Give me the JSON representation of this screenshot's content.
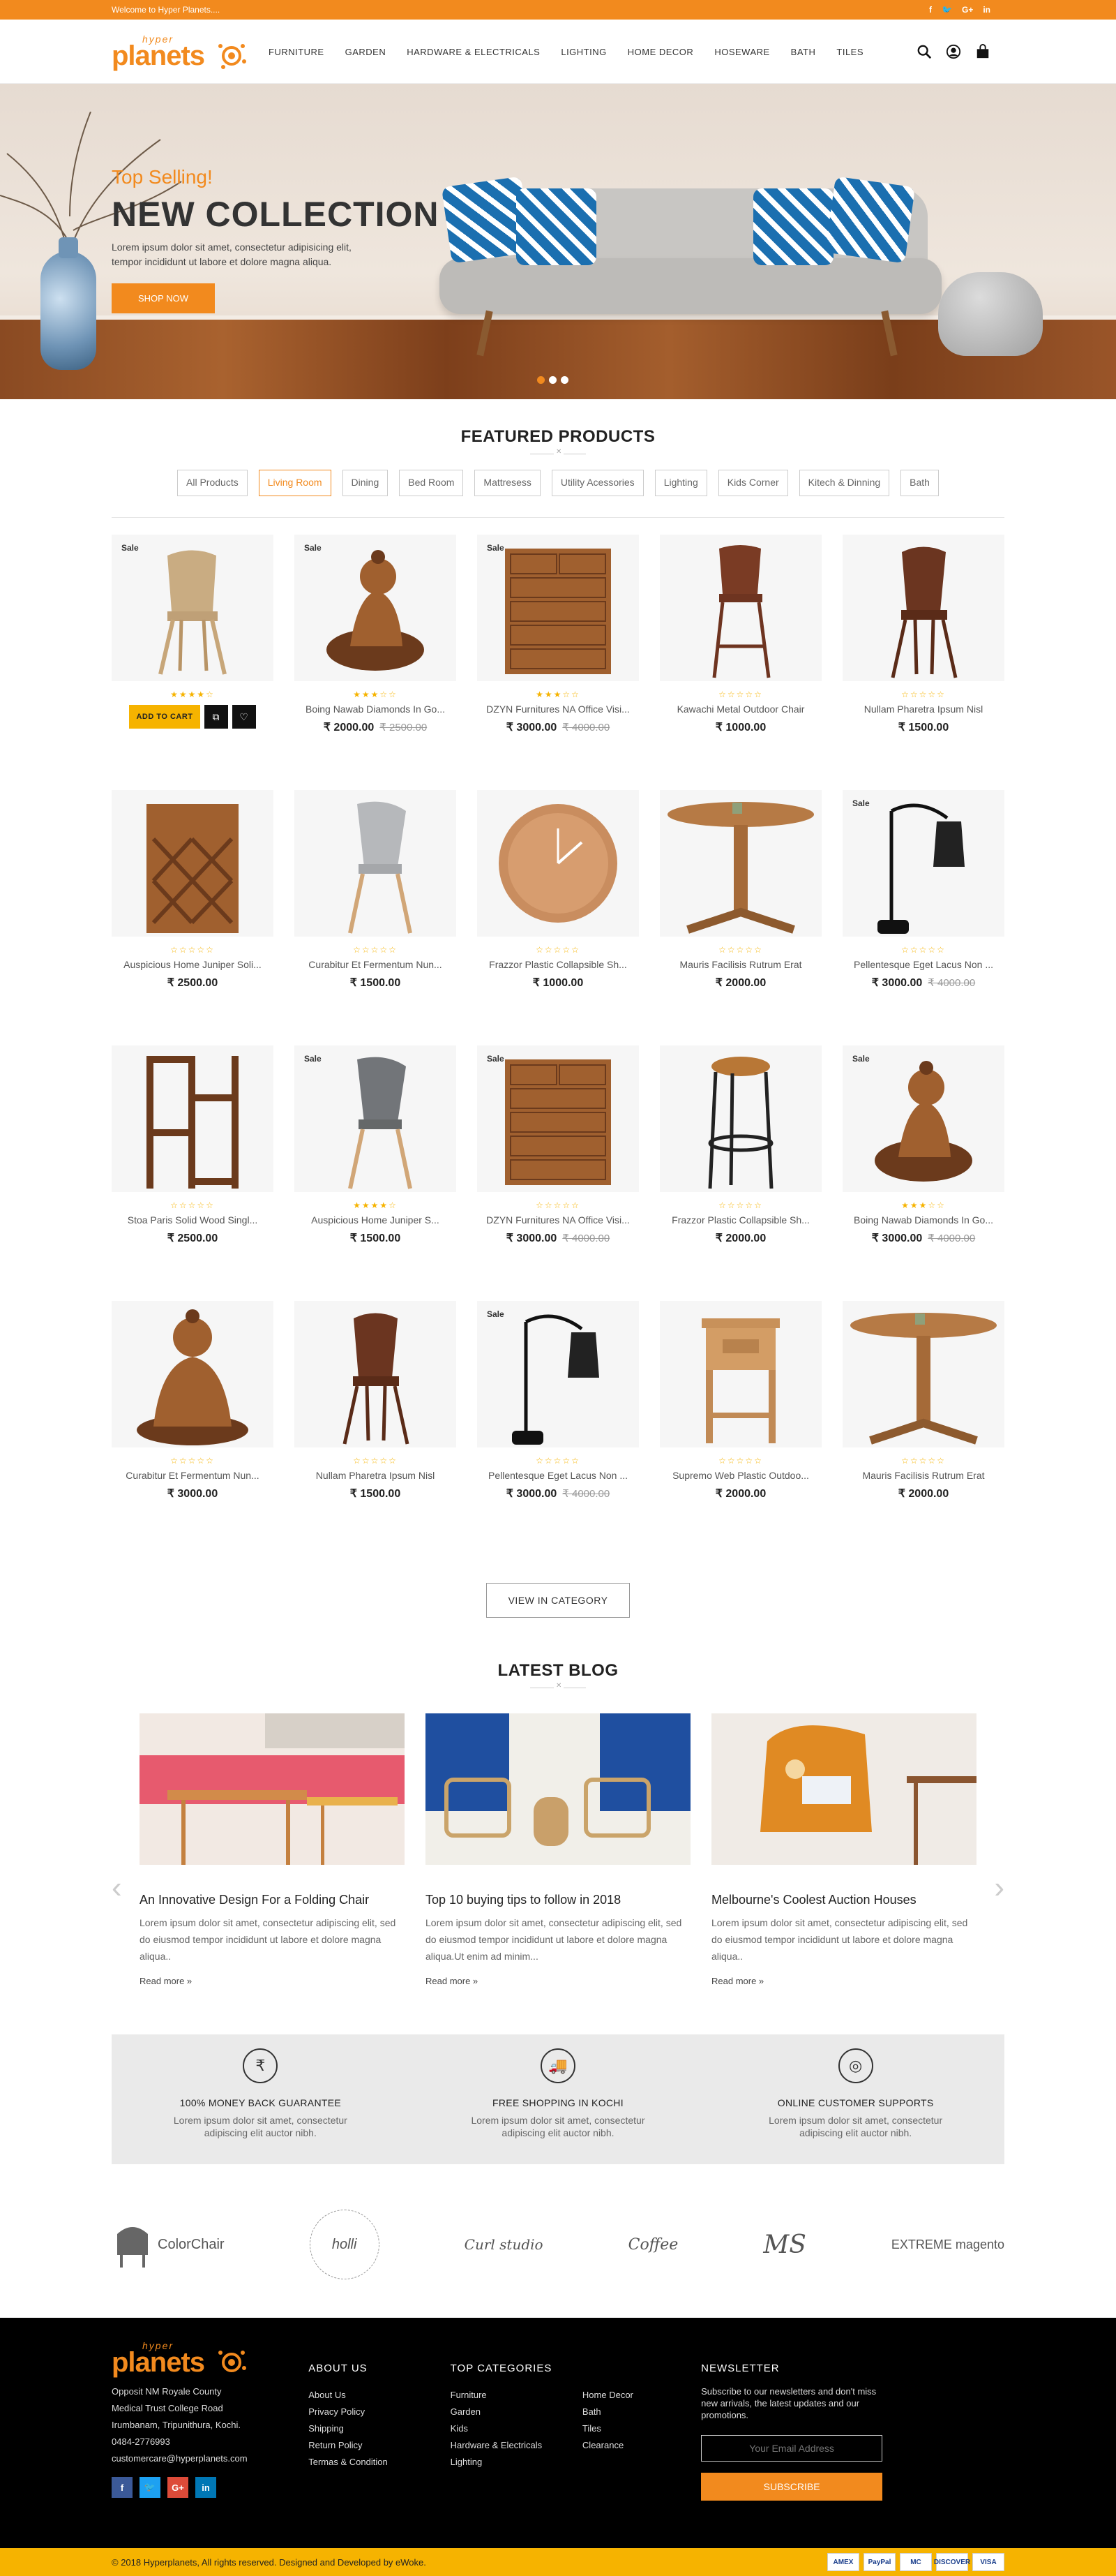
{
  "topbar": {
    "welcome": "Welcome to Hyper Planets....",
    "social": [
      "f",
      "t",
      "G+",
      "in"
    ]
  },
  "logo": {
    "small": "hyper",
    "big": "planets"
  },
  "nav": [
    "FURNITURE",
    "GARDEN",
    "HARDWARE & ELECTRICALS",
    "LIGHTING",
    "HOME DECOR",
    "HOSEWARE",
    "BATH",
    "TILES"
  ],
  "hero": {
    "sub": "Top Selling!",
    "title": "NEW COLLECTION",
    "text": "Lorem ipsum dolor sit amet, consectetur adipisicing elit, tempor incididunt ut labore et dolore magna aliqua.",
    "button": "SHOP NOW"
  },
  "featured": {
    "title": "FEATURED PRODUCTS",
    "filters": [
      "All Products",
      "Living Room",
      "Dining",
      "Bed Room",
      "Mattresess",
      "Utility Acessories",
      "Lighting",
      "Kids Corner",
      "Kitech & Dinning",
      "Bath"
    ],
    "active_filter": 1,
    "products": [
      {
        "name": "",
        "sale": "Sale",
        "price": "",
        "old": "",
        "img": "chair-wood",
        "stars": 4,
        "cart": true
      },
      {
        "name": "Boing Nawab Diamonds In Go...",
        "sale": "Sale",
        "price": "₹ 2000.00",
        "old": "₹ 2500.00",
        "img": "buddha",
        "stars": 3
      },
      {
        "name": "DZYN Furnitures NA Office Visi...",
        "sale": "Sale",
        "price": "₹ 3000.00",
        "old": "₹ 4000.00",
        "img": "drawers",
        "stars": 3
      },
      {
        "name": "Kawachi Metal Outdoor Chair",
        "sale": "",
        "price": "₹ 1000.00",
        "old": "",
        "img": "stool-high",
        "stars": 0
      },
      {
        "name": "Nullam Pharetra Ipsum Nisl",
        "sale": "",
        "price": "₹ 1500.00",
        "old": "",
        "img": "chair-brown",
        "stars": 0
      },
      {
        "name": "Auspicious Home Juniper Soli...",
        "sale": "",
        "price": "₹ 2500.00",
        "old": "",
        "img": "wine-rack",
        "stars": 0
      },
      {
        "name": "Curabitur Et Fermentum Nun...",
        "sale": "",
        "price": "₹ 1500.00",
        "old": "",
        "img": "chair-grey",
        "stars": 0
      },
      {
        "name": "Frazzor Plastic Collapsible Sh...",
        "sale": "",
        "price": "₹ 1000.00",
        "old": "",
        "img": "clock",
        "stars": 0
      },
      {
        "name": "Mauris Facilisis Rutrum Erat",
        "sale": "",
        "price": "₹ 2000.00",
        "old": "",
        "img": "table",
        "stars": 0
      },
      {
        "name": "Pellentesque Eget Lacus Non ...",
        "sale": "Sale",
        "price": "₹ 3000.00",
        "old": "₹ 4000.00",
        "img": "lamp",
        "stars": 0
      },
      {
        "name": "Stoa Paris Solid Wood Singl...",
        "sale": "",
        "price": "₹ 2500.00",
        "old": "",
        "img": "shelf",
        "stars": 0
      },
      {
        "name": "Auspicious Home Juniper S...",
        "sale": "Sale",
        "price": "₹ 1500.00",
        "old": "",
        "img": "chair-darkgrey",
        "stars": 4
      },
      {
        "name": "DZYN Furnitures NA Office Visi...",
        "sale": "Sale",
        "price": "₹ 3000.00",
        "old": "₹ 4000.00",
        "img": "drawers",
        "stars": 0
      },
      {
        "name": "Frazzor Plastic Collapsible Sh...",
        "sale": "",
        "price": "₹ 2000.00",
        "old": "",
        "img": "stool-round",
        "stars": 0
      },
      {
        "name": "Boing Nawab Diamonds In Go...",
        "sale": "Sale",
        "price": "₹ 3000.00",
        "old": "₹ 4000.00",
        "img": "buddha",
        "stars": 3
      },
      {
        "name": "Curabitur Et Fermentum Nun...",
        "sale": "",
        "price": "₹ 3000.00",
        "old": "",
        "img": "buddha-sit",
        "stars": 0
      },
      {
        "name": "Nullam Pharetra Ipsum Nisl",
        "sale": "",
        "price": "₹ 1500.00",
        "old": "",
        "img": "chair-brown",
        "stars": 0
      },
      {
        "name": "Pellentesque Eget Lacus Non ...",
        "sale": "Sale",
        "price": "₹ 3000.00",
        "old": "₹ 4000.00",
        "img": "lamp",
        "stars": 0
      },
      {
        "name": "Supremo Web Plastic Outdoo...",
        "sale": "",
        "price": "₹ 2000.00",
        "old": "",
        "img": "side-table",
        "stars": 0
      },
      {
        "name": "Mauris Facilisis Rutrum Erat",
        "sale": "",
        "price": "₹ 2000.00",
        "old": "",
        "img": "table",
        "stars": 0
      }
    ],
    "cart_label": "ADD TO CART",
    "view_button": "VIEW IN CATEGORY"
  },
  "blog": {
    "title": "LATEST BLOG",
    "posts": [
      {
        "title": "An Innovative Design For a Folding Chair",
        "text": "Lorem ipsum dolor sit amet, consectetur adipiscing elit, sed do eiusmod tempor incididunt ut labore et dolore magna aliqua..",
        "more": "Read more »",
        "img": "pink"
      },
      {
        "title": "Top 10 buying tips to follow in 2018",
        "text": "Lorem ipsum dolor sit amet, consectetur adipiscing elit, sed do eiusmod tempor incididunt ut labore et dolore magna aliqua.Ut enim ad minim...",
        "more": "Read more »",
        "img": "blue"
      },
      {
        "title": "Melbourne's Coolest Auction Houses",
        "text": "Lorem ipsum dolor sit amet, consectetur adipiscing elit, sed do eiusmod tempor incididunt ut labore et dolore magna aliqua..",
        "more": "Read more »",
        "img": "orange"
      }
    ]
  },
  "features": [
    {
      "icon": "₹",
      "title": "100% MONEY BACK GUARANTEE",
      "text": "Lorem ipsum dolor sit amet, consectetur adipiscing elit auctor nibh."
    },
    {
      "icon": "🚚",
      "title": "FREE SHOPPING IN KOCHI",
      "text": "Lorem ipsum dolor sit amet, consectetur adipiscing elit auctor nibh."
    },
    {
      "icon": "◎",
      "title": "ONLINE CUSTOMER SUPPORTS",
      "text": "Lorem ipsum dolor sit amet, consectetur adipiscing elit auctor nibh."
    }
  ],
  "brands": [
    "ColorChair",
    "holli",
    "Curl studio",
    "Coffee",
    "MS",
    "EXTREME magento"
  ],
  "footer": {
    "address": [
      "Opposit NM Royale County",
      "Medical Trust College Road",
      "Irumbanam, Tripunithura, Kochi.",
      "0484-2776993",
      "customercare@hyperplanets.com"
    ],
    "about_title": "ABOUT US",
    "about": [
      "About Us",
      "Privacy Policy",
      "Shipping",
      "Return Policy",
      "Termas & Condition"
    ],
    "cat_title": "TOP CATEGORIES",
    "cats1": [
      "Furniture",
      "Garden",
      "Kids",
      "Hardware & Electricals",
      "Lighting"
    ],
    "cats2": [
      "Home Decor",
      "Bath",
      "Tiles",
      "Clearance"
    ],
    "nl_title": "NEWSLETTER",
    "nl_text": "Subscribe to our newsletters and don't miss new arrivals, the latest updates and our promotions.",
    "nl_placeholder": "Your Email Address",
    "nl_button": "SUBSCRIBE",
    "social": [
      "f",
      "t",
      "G+",
      "in"
    ],
    "copyright": "© 2018 Hyperplanets, All rights reserved. Designed and Developed by eWoke.",
    "payments": [
      "AMEX",
      "PayPal",
      "MC",
      "DISCOVER",
      "VISA"
    ]
  }
}
